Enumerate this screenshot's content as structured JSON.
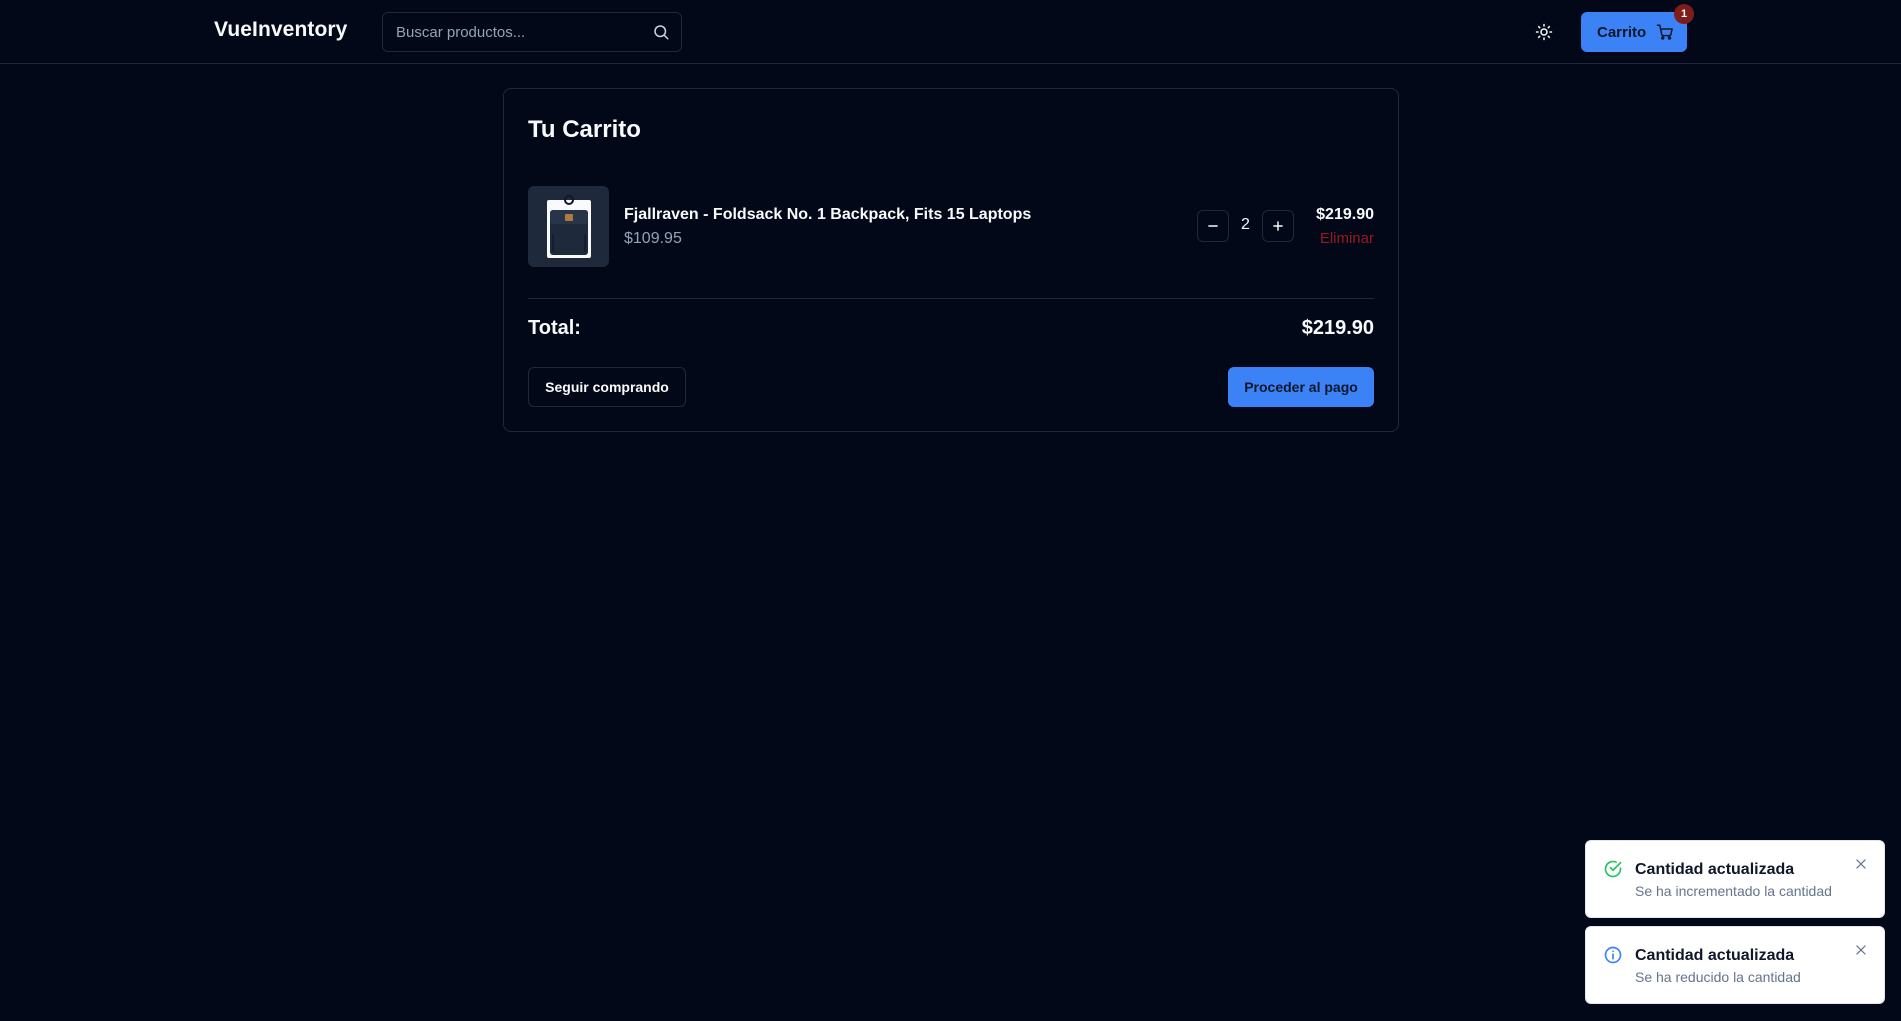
{
  "header": {
    "logo": "VueInventory",
    "search_placeholder": "Buscar productos...",
    "cart_label": "Carrito",
    "cart_badge": "1"
  },
  "cart": {
    "title": "Tu Carrito",
    "items": [
      {
        "name": "Fjallraven - Foldsack No. 1 Backpack, Fits 15 Laptops",
        "unit_price": "$109.95",
        "quantity": "2",
        "line_total": "$219.90",
        "remove_label": "Eliminar"
      }
    ],
    "total_label": "Total:",
    "total_value": "$219.90",
    "continue_label": "Seguir comprando",
    "checkout_label": "Proceder al pago"
  },
  "toasts": [
    {
      "title": "Cantidad actualizada",
      "description": "Se ha incrementado la cantidad",
      "icon": "check-circle-icon",
      "color": "#22c55e"
    },
    {
      "title": "Cantidad actualizada",
      "description": "Se ha reducido la cantidad",
      "icon": "info-icon",
      "color": "#3b82f6"
    }
  ],
  "colors": {
    "background": "#020817",
    "accent": "#3b82f6",
    "danger": "#991b1b"
  }
}
